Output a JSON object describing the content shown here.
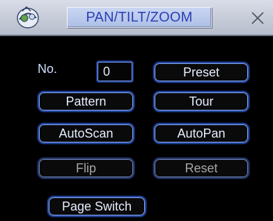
{
  "window": {
    "title": "PAN/TILT/ZOOM"
  },
  "form": {
    "no_label": "No.",
    "no_value": "0"
  },
  "buttons": {
    "preset": "Preset",
    "pattern": "Pattern",
    "tour": "Tour",
    "autoscan": "AutoScan",
    "autopan": "AutoPan",
    "flip": "Flip",
    "reset": "Reset",
    "page_switch": "Page Switch"
  },
  "states": {
    "flip_enabled": false,
    "reset_enabled": false
  },
  "icons": {
    "logo": "ptz-app-logo-icon",
    "close": "close-icon"
  },
  "colors": {
    "title_text": "#2a3fb5",
    "button_border": "#24469c",
    "disabled_text": "#a7a7a7",
    "background": "#000000"
  }
}
